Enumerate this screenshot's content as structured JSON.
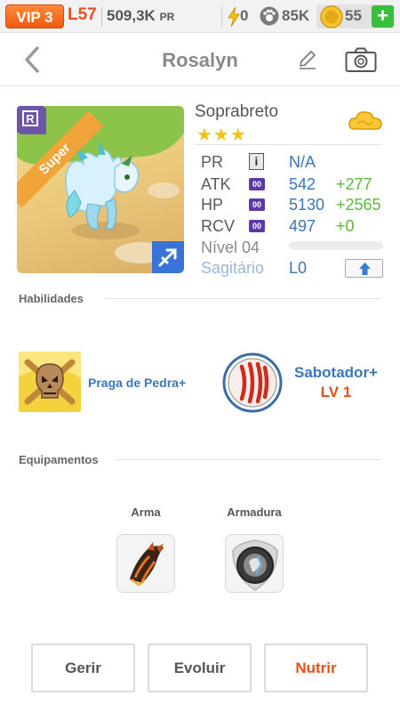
{
  "status_bar": {
    "vip": "VIP 3",
    "level": "L57",
    "power": "509,3K",
    "power_unit": "PR",
    "energy": "0",
    "paw": "85K",
    "coins": "55",
    "add_label": "+"
  },
  "header": {
    "title": "Rosalyn"
  },
  "monster": {
    "rarity_badge": "R",
    "tier": "Super",
    "name": "Soprabreto",
    "stars": "★★★",
    "stats": [
      {
        "label": "PR",
        "value": "N/A",
        "bonus": "",
        "icon": "info-icon"
      },
      {
        "label": "ATK",
        "value": "542",
        "bonus": "+277",
        "icon": "00"
      },
      {
        "label": "HP",
        "value": "5130",
        "bonus": "+2565",
        "icon": "00"
      },
      {
        "label": "RCV",
        "value": "497",
        "bonus": "+0",
        "icon": "00"
      }
    ],
    "level_label": "Nível 04",
    "level_progress": 0,
    "sign_label": "Sagitário",
    "sign_value": "L0",
    "colors": {
      "accent_blue": "#3a76b8",
      "bonus_green": "#5bb83e",
      "orange": "#e2521a"
    }
  },
  "abilities": {
    "title": "Habilidades",
    "skill1": {
      "name": "Praga de Pedra+"
    },
    "skill2": {
      "name": "Sabotador+",
      "level": "LV 1"
    }
  },
  "equipment": {
    "title": "Equipamentos",
    "weapon_label": "Arma",
    "armor_label": "Armadura"
  },
  "actions": {
    "manage": "Gerir",
    "evolve": "Evoluir",
    "feed": "Nutrir"
  }
}
